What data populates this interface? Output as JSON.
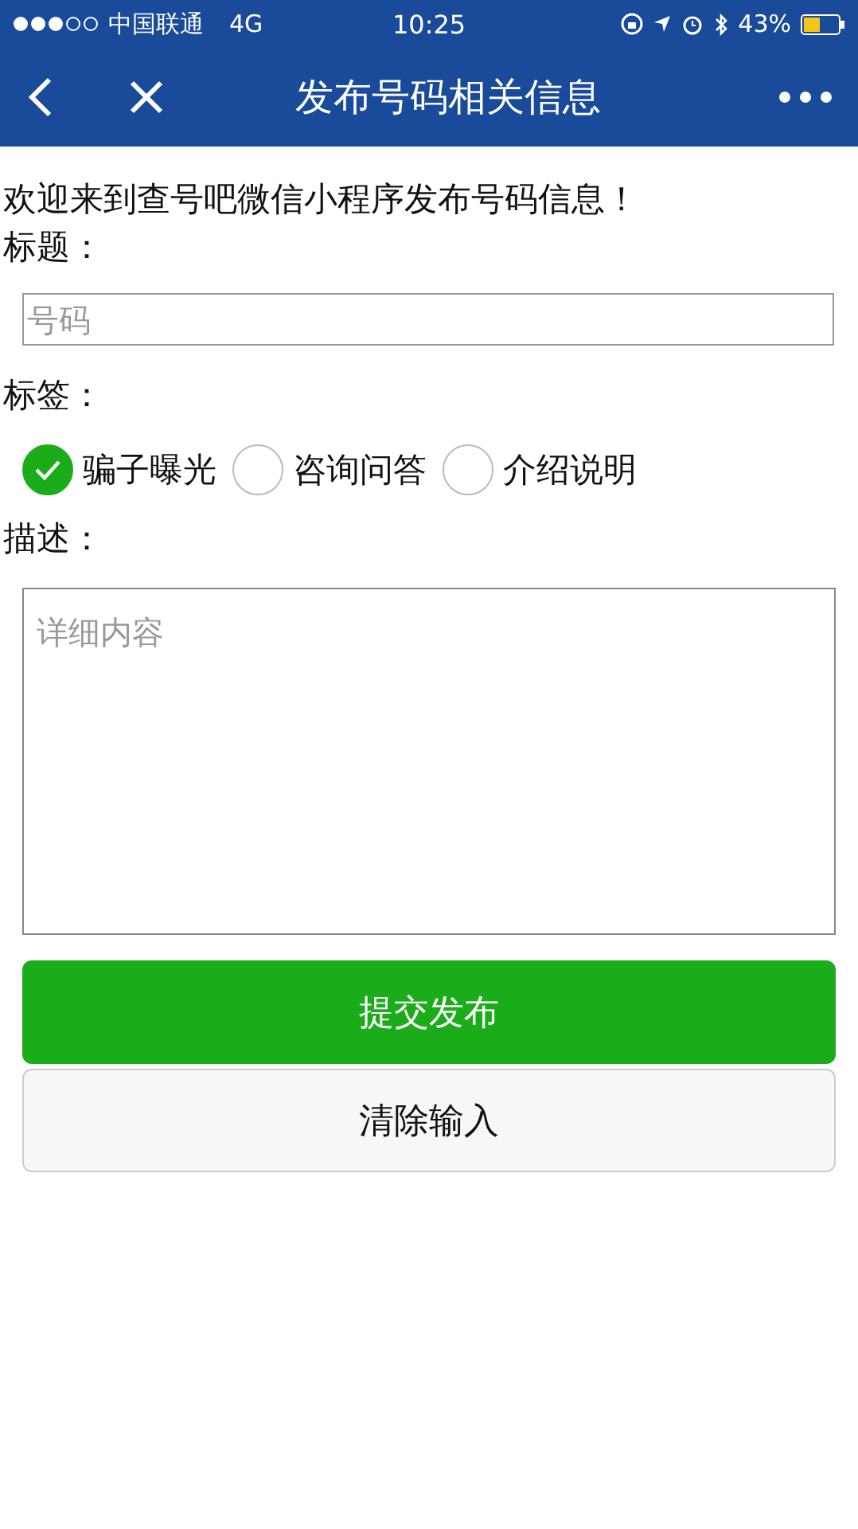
{
  "status_bar": {
    "carrier": "中国联通",
    "network": "4G",
    "time": "10:25",
    "battery": "43%"
  },
  "nav_bar": {
    "title": "发布号码相关信息"
  },
  "welcome": "欢迎来到查号吧微信小程序发布号码信息！",
  "title_label": "标题：",
  "title_field": {
    "placeholder": "号码"
  },
  "tag_label": "标签：",
  "tags": [
    {
      "label": "骗子曝光",
      "selected": true
    },
    {
      "label": "咨询问答",
      "selected": false
    },
    {
      "label": "介绍说明",
      "selected": false
    }
  ],
  "desc_label": "描述：",
  "desc_field": {
    "placeholder": "详细内容"
  },
  "buttons": [
    {
      "label": "提交发布",
      "kind": "primary"
    },
    {
      "label": "清除输入",
      "kind": "default"
    }
  ]
}
